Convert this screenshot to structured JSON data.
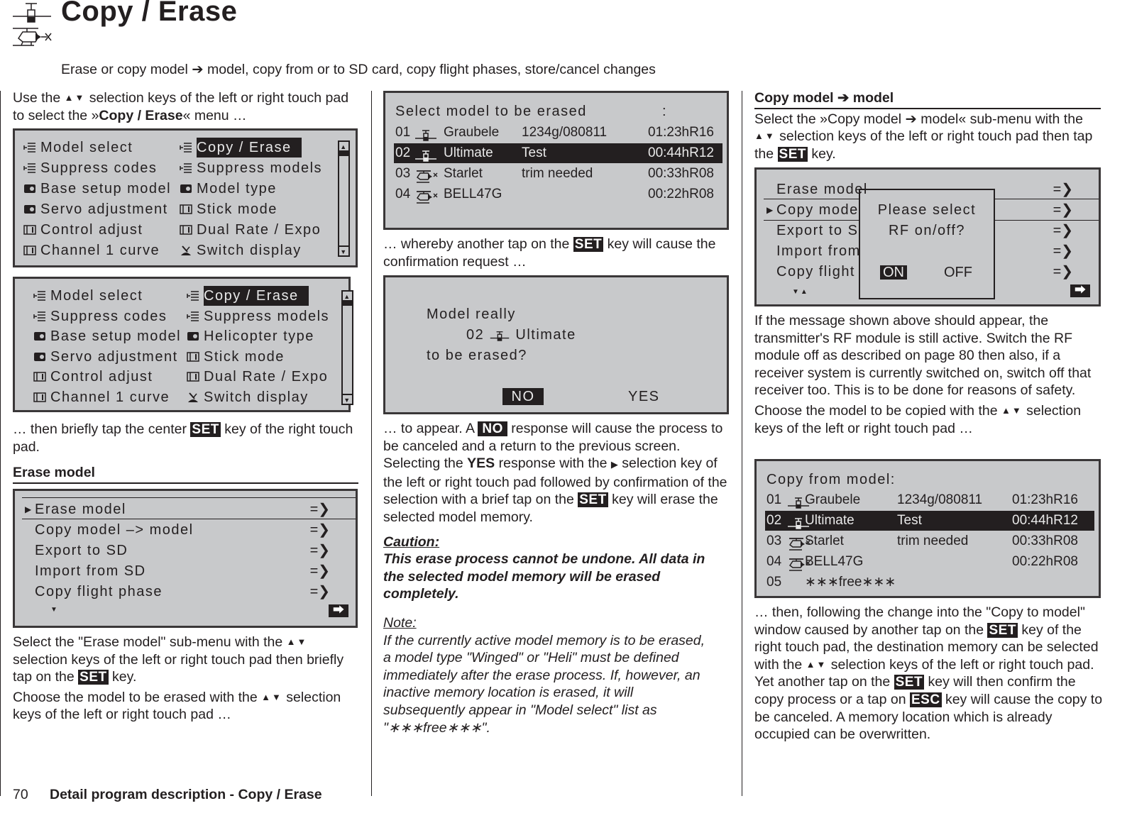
{
  "header": {
    "title": "Copy / Erase",
    "subtitle": "Erase or copy model ➔ model, copy from or to SD card, copy flight phases, store/cancel changes",
    "icon": "winged-and-helicopter-model-icon"
  },
  "keys": {
    "set": "SET",
    "esc": "ESC",
    "no": "NO",
    "yes": "YES",
    "updown": "▲▼",
    "right": "▶"
  },
  "col1": {
    "intro_a": "Use the ",
    "intro_b": " selection keys of the left or right touch pad to select the »",
    "intro_bold": "Copy / Erase",
    "intro_c": "« menu …",
    "menu_winged": {
      "left": [
        "Model select",
        "Suppress codes",
        "Base setup model",
        "Servo adjustment",
        "Control adjust",
        "Channel 1 curve"
      ],
      "right": [
        "Copy / Erase",
        "Suppress models",
        "Model type",
        "Stick mode",
        "Dual Rate / Expo",
        "Switch display"
      ],
      "selected": "Copy / Erase"
    },
    "menu_heli": {
      "left": [
        "Model select",
        "Suppress codes",
        "Base setup model",
        "Servo adjustment",
        "Control adjust",
        "Channel 1 curve"
      ],
      "right": [
        "Copy / Erase",
        "Suppress models",
        "Helicopter type",
        "Stick mode",
        "Dual Rate / Expo",
        "Switch display"
      ],
      "selected": "Copy / Erase"
    },
    "then_a": "… then briefly tap the center ",
    "then_b": " key of the right touch pad.",
    "erase_heading": "Erase model",
    "submenu": {
      "items": [
        "Erase model",
        "Copy model –> model",
        "Export to SD",
        "Import from SD",
        "Copy flight phase"
      ],
      "selected_index": 0,
      "arrow": "=>"
    },
    "select_a": "Select the \"Erase model\" sub-menu with the ",
    "select_b": " selection keys of the left or right touch pad then briefly tap on the ",
    "select_c": " key.",
    "choose_a": "Choose the model to be erased with the ",
    "choose_b": " selection keys of the left or right touch pad …"
  },
  "col2": {
    "erase_screen": {
      "title": "Select model to be erased",
      "colon": ":",
      "models": [
        {
          "num": "01",
          "type": "winged",
          "name": "Graubele",
          "info": "1234g/080811",
          "time": "01:23hR16"
        },
        {
          "num": "02",
          "type": "winged",
          "name": "Ultimate",
          "info": "Test",
          "time": "00:44hR12"
        },
        {
          "num": "03",
          "type": "heli",
          "name": "Starlet",
          "info": "trim needed",
          "time": "00:33hR08"
        },
        {
          "num": "04",
          "type": "heli",
          "name": "BELL47G",
          "info": "",
          "time": "00:22hR08"
        }
      ],
      "selected_index": 1
    },
    "whereby_a": "… whereby another tap on the ",
    "whereby_b": " key will cause the confirmation request …",
    "confirm": {
      "line1": "Model really",
      "model_num": "02",
      "model_name": "Ultimate",
      "line3": "to be erased?",
      "no": "NO",
      "yes": "YES"
    },
    "appear_a": "… to appear. A ",
    "appear_b": " response will cause the process to be canceled and a return to the previous screen. Selecting the ",
    "appear_yes": "YES",
    "appear_c": " response with the ",
    "appear_d": " selection key of the left or right touch pad followed by confirmation of the selection with a brief tap on the ",
    "appear_e": " key will erase the selected model memory.",
    "caution_label": "Caution:",
    "caution_text": "This erase process cannot be undone. All data in the selected model memory will be erased completely.",
    "note_label": "Note:",
    "note_text": "If the currently active model memory is to be erased, a model type \"Winged\" or \"Heli\" must be defined immediately after the erase process. If, however, an inactive memory location is erased, it will subsequently appear in \"Model select\" list as \"∗∗∗free∗∗∗\"."
  },
  "col3": {
    "heading": "Copy model ➔ model",
    "select_a": "Select the »Copy model ➔ model« sub-menu with the ",
    "select_b": " selection keys of the left or right touch pad then tap the ",
    "select_c": " key.",
    "rf_screen": {
      "items": [
        "Erase model",
        "Copy mode",
        "Export to S",
        "Import from",
        "Copy flight"
      ],
      "selected_index": 1,
      "arrow": "=>",
      "dialog_line1": "Please select",
      "dialog_line2": "RF on/off?",
      "on": "ON",
      "off": "OFF"
    },
    "msg_text": "If the message shown above should appear, the transmitter's RF module is still active. Switch the RF module off as described on page 80 then also, if a receiver system is currently switched on, switch off that receiver too. This is to be done for reasons of safety.",
    "choose_a": "Choose the model to be copied with the ",
    "choose_b": " selection keys of the left or right touch pad …",
    "copy_screen": {
      "title": "Copy from model:",
      "models": [
        {
          "num": "01",
          "type": "winged",
          "name": "Graubele",
          "info": "1234g/080811",
          "time": "01:23hR16"
        },
        {
          "num": "02",
          "type": "winged",
          "name": "Ultimate",
          "info": "Test",
          "time": "00:44hR12"
        },
        {
          "num": "03",
          "type": "heli",
          "name": "Starlet",
          "info": "trim needed",
          "time": "00:33hR08"
        },
        {
          "num": "04",
          "type": "heli",
          "name": "BELL47G",
          "info": "",
          "time": "00:22hR08"
        },
        {
          "num": "05",
          "type": "",
          "name": "∗∗∗free∗∗∗",
          "info": "",
          "time": ""
        }
      ],
      "selected_index": 1
    },
    "then_a": "… then, following the change into the \"Copy to model\" window caused by another tap on the ",
    "then_b": " key of the right touch pad, the destination memory can be selected with the ",
    "then_c": " selection keys of the left or right touch pad. Yet another tap on the ",
    "then_d": " key will then confirm the copy process or a tap on ",
    "then_e": " key will cause the copy to be canceled. A memory location which is already occupied can be overwritten."
  },
  "footer": {
    "page_number": "70",
    "text": "Detail program description - Copy / Erase"
  }
}
